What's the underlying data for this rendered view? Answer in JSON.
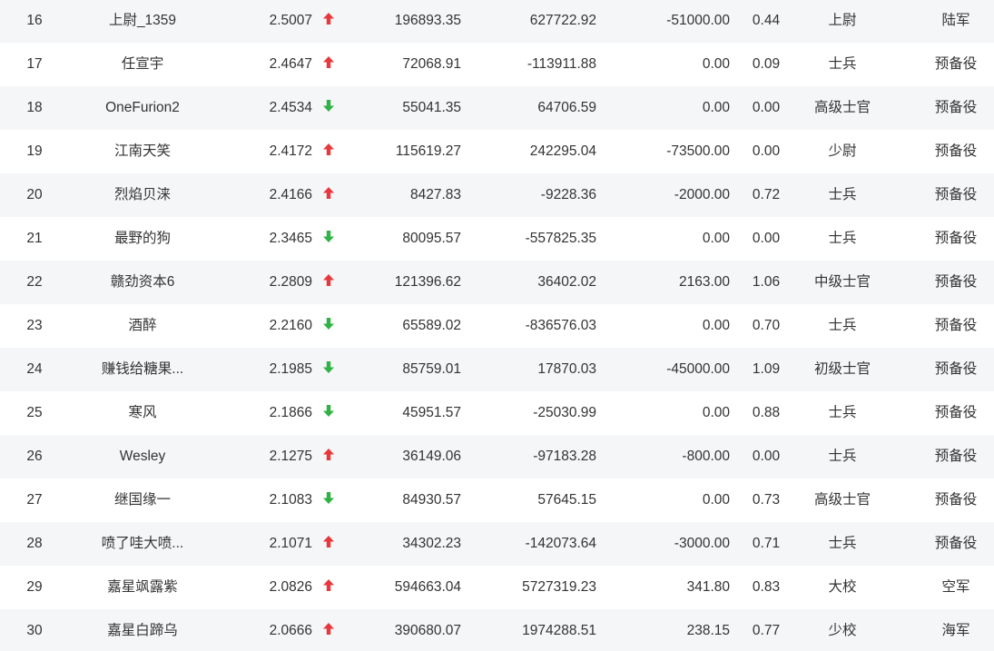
{
  "colors": {
    "up": "#e8383d",
    "down": "#2fb344",
    "stripe": "#f5f6f8",
    "text": "#333333"
  },
  "rows": [
    {
      "rank": "16",
      "name": "上尉_1359",
      "score": "2.5007",
      "trend": "up",
      "v1": "196893.35",
      "v2": "627722.92",
      "v3": "-51000.00",
      "v4": "0.44",
      "title": "上尉",
      "branch": "陆军"
    },
    {
      "rank": "17",
      "name": "任宣宇",
      "score": "2.4647",
      "trend": "up",
      "v1": "72068.91",
      "v2": "-113911.88",
      "v3": "0.00",
      "v4": "0.09",
      "title": "士兵",
      "branch": "预备役"
    },
    {
      "rank": "18",
      "name": "OneFurion2",
      "score": "2.4534",
      "trend": "down",
      "v1": "55041.35",
      "v2": "64706.59",
      "v3": "0.00",
      "v4": "0.00",
      "title": "高级士官",
      "branch": "预备役"
    },
    {
      "rank": "19",
      "name": "江南天笑",
      "score": "2.4172",
      "trend": "up",
      "v1": "115619.27",
      "v2": "242295.04",
      "v3": "-73500.00",
      "v4": "0.00",
      "title": "少尉",
      "branch": "预备役"
    },
    {
      "rank": "20",
      "name": "烈焰贝涞",
      "score": "2.4166",
      "trend": "up",
      "v1": "8427.83",
      "v2": "-9228.36",
      "v3": "-2000.00",
      "v4": "0.72",
      "title": "士兵",
      "branch": "预备役"
    },
    {
      "rank": "21",
      "name": "最野的狗",
      "score": "2.3465",
      "trend": "down",
      "v1": "80095.57",
      "v2": "-557825.35",
      "v3": "0.00",
      "v4": "0.00",
      "title": "士兵",
      "branch": "预备役"
    },
    {
      "rank": "22",
      "name": "赣劲资本6",
      "score": "2.2809",
      "trend": "up",
      "v1": "121396.62",
      "v2": "36402.02",
      "v3": "2163.00",
      "v4": "1.06",
      "title": "中级士官",
      "branch": "预备役"
    },
    {
      "rank": "23",
      "name": "酒醉",
      "score": "2.2160",
      "trend": "down",
      "v1": "65589.02",
      "v2": "-836576.03",
      "v3": "0.00",
      "v4": "0.70",
      "title": "士兵",
      "branch": "预备役"
    },
    {
      "rank": "24",
      "name": "赚钱给糖果...",
      "score": "2.1985",
      "trend": "down",
      "v1": "85759.01",
      "v2": "17870.03",
      "v3": "-45000.00",
      "v4": "1.09",
      "title": "初级士官",
      "branch": "预备役"
    },
    {
      "rank": "25",
      "name": "寒风",
      "score": "2.1866",
      "trend": "down",
      "v1": "45951.57",
      "v2": "-25030.99",
      "v3": "0.00",
      "v4": "0.88",
      "title": "士兵",
      "branch": "预备役"
    },
    {
      "rank": "26",
      "name": "Wesley",
      "score": "2.1275",
      "trend": "up",
      "v1": "36149.06",
      "v2": "-97183.28",
      "v3": "-800.00",
      "v4": "0.00",
      "title": "士兵",
      "branch": "预备役"
    },
    {
      "rank": "27",
      "name": "继国缘一",
      "score": "2.1083",
      "trend": "down",
      "v1": "84930.57",
      "v2": "57645.15",
      "v3": "0.00",
      "v4": "0.73",
      "title": "高级士官",
      "branch": "预备役"
    },
    {
      "rank": "28",
      "name": "喷了哇大喷...",
      "score": "2.1071",
      "trend": "up",
      "v1": "34302.23",
      "v2": "-142073.64",
      "v3": "-3000.00",
      "v4": "0.71",
      "title": "士兵",
      "branch": "预备役"
    },
    {
      "rank": "29",
      "name": "嘉星飒露紫",
      "score": "2.0826",
      "trend": "up",
      "v1": "594663.04",
      "v2": "5727319.23",
      "v3": "341.80",
      "v4": "0.83",
      "title": "大校",
      "branch": "空军"
    },
    {
      "rank": "30",
      "name": "嘉星白蹄乌",
      "score": "2.0666",
      "trend": "up",
      "v1": "390680.07",
      "v2": "1974288.51",
      "v3": "238.15",
      "v4": "0.77",
      "title": "少校",
      "branch": "海军"
    }
  ]
}
